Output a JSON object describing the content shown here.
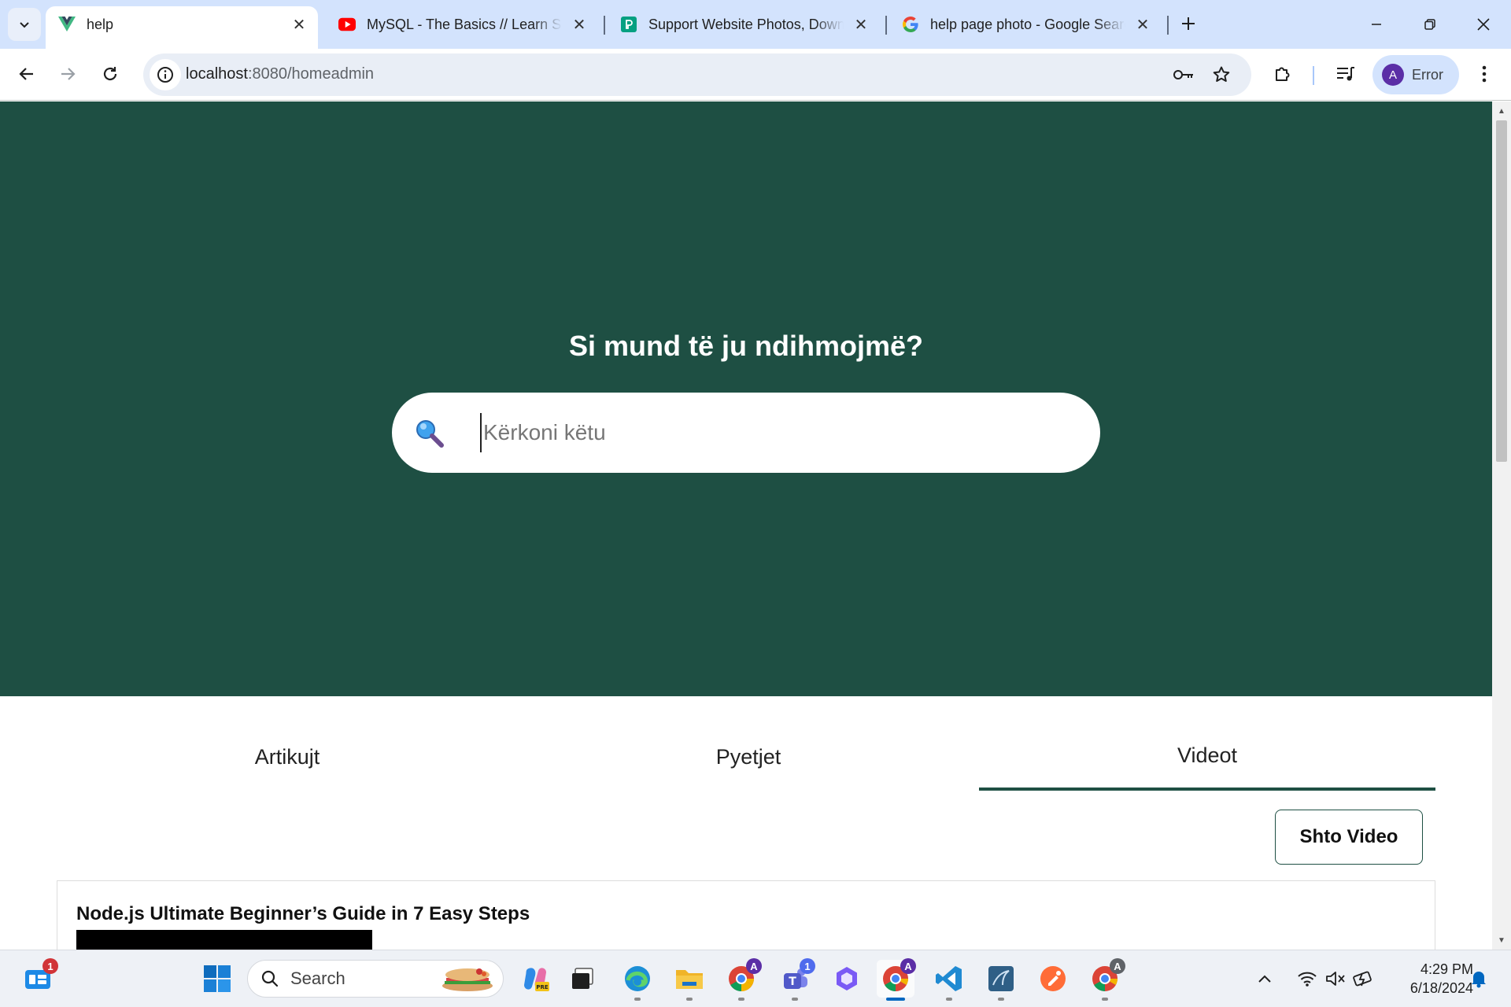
{
  "browser": {
    "tabs": [
      {
        "title": "help",
        "favicon": "vue-icon",
        "active": true
      },
      {
        "title": "MySQL - The Basics // Learn SQL",
        "favicon": "youtube-icon",
        "active": false
      },
      {
        "title": "Support Website Photos, Download",
        "favicon": "pexels-icon",
        "active": false
      },
      {
        "title": "help page photo - Google Search",
        "favicon": "google-icon",
        "active": false
      }
    ],
    "url": {
      "host": "localhost",
      "rest": ":8080/homeadmin"
    },
    "profile_label": "Error",
    "profile_initial": "A"
  },
  "page": {
    "hero_title": "Si mund të ju ndihmojmë?",
    "search_placeholder": "Kërkoni këtu",
    "search_value": "",
    "tabs": [
      {
        "label": "Artikujt",
        "active": false
      },
      {
        "label": "Pyetjet",
        "active": false
      },
      {
        "label": "Videot",
        "active": true
      }
    ],
    "add_video_label": "Shto Video",
    "videos": [
      {
        "title": "Node.js Ultimate Beginner’s Guide in 7 Easy Steps"
      }
    ],
    "colors": {
      "hero_bg": "#1e4f43",
      "accent": "#1e4f43"
    }
  },
  "taskbar": {
    "search_label": "Search",
    "widgets_badge": "1",
    "teams_badge": "1",
    "chrome_profile_badge": "A",
    "time": "4:29 PM",
    "date": "6/18/2024"
  }
}
